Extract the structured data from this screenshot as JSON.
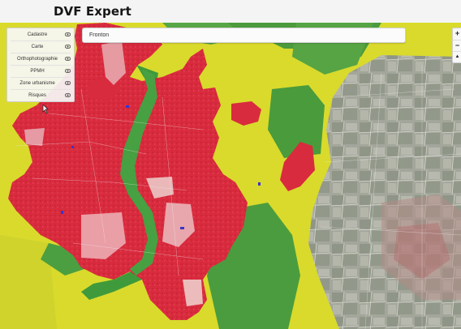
{
  "app": {
    "title": "DVF Expert"
  },
  "layers": [
    {
      "label": "Cadastre",
      "icon": "eye-icon"
    },
    {
      "label": "Carte",
      "icon": "eye-icon"
    },
    {
      "label": "Orthophotographie",
      "icon": "eye-icon"
    },
    {
      "label": "PPMH",
      "icon": "eye-icon"
    },
    {
      "label": "Zone urbanisme",
      "icon": "eye-icon"
    },
    {
      "label": "Risques",
      "icon": "eye-icon"
    }
  ],
  "search": {
    "value": "Fronton"
  },
  "zoom": {
    "in": "+",
    "out": "−",
    "compass": "▲"
  },
  "map": {
    "colors": {
      "urban_zone": "#d92b3e",
      "urban_zone_light": "#ea9ea6",
      "agricultural_zone": "#dcdc2a",
      "natural_zone": "#4a9e3c",
      "aerial_photo": "#9ea196"
    }
  }
}
